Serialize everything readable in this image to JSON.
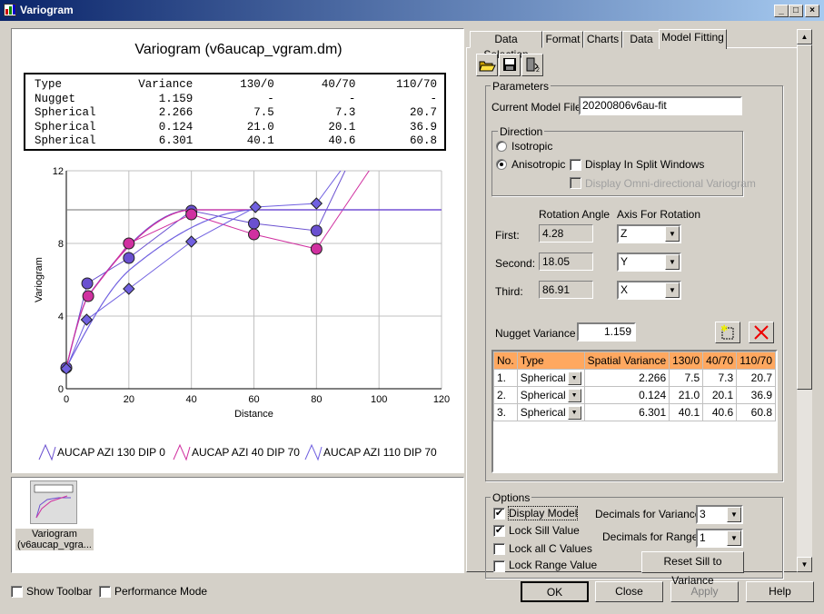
{
  "window": {
    "title": "Variogram",
    "icon": "variogram-app-icon",
    "buttons": [
      "minimize",
      "maximize",
      "close"
    ]
  },
  "chart_panel": {
    "title": "Variogram (v6aucap_vgram.dm)",
    "summary_table": {
      "headers": [
        "Type",
        "Variance",
        "130/0",
        "40/70",
        "110/70"
      ],
      "rows": [
        [
          "Nugget",
          "1.159",
          "-",
          "-",
          "-"
        ],
        [
          "Spherical",
          "2.266",
          "7.5",
          "7.3",
          "20.7"
        ],
        [
          "Spherical",
          "0.124",
          "21.0",
          "20.1",
          "36.9"
        ],
        [
          "Spherical",
          "6.301",
          "40.1",
          "40.6",
          "60.8"
        ]
      ]
    }
  },
  "chart_data": {
    "type": "line",
    "xlabel": "Distance",
    "ylabel": "Variogram",
    "xlim": [
      0,
      120
    ],
    "ylim": [
      0,
      12
    ],
    "xticks": [
      0,
      20,
      40,
      60,
      80,
      100,
      120
    ],
    "yticks": [
      0,
      4,
      8,
      12
    ],
    "grid": true,
    "legend_placement": "bottom",
    "sill": 9.85,
    "nugget": 1.159,
    "structures": [
      2.266,
      0.124,
      6.301
    ],
    "series": [
      {
        "name": "AUCAP AZI 130 DIP 0",
        "color": "#6a50d0",
        "marker": "circle",
        "ranges": [
          7.5,
          21.0,
          40.1
        ],
        "points": [
          [
            0,
            1.159
          ],
          [
            6.7,
            5.8
          ],
          [
            20,
            7.2
          ],
          [
            40,
            9.8
          ],
          [
            60,
            9.1
          ],
          [
            80,
            8.7
          ],
          [
            90,
            12.3
          ]
        ]
      },
      {
        "name": "AUCAP AZI 40 DIP 70",
        "color": "#d030a0",
        "marker": "circle",
        "ranges": [
          7.3,
          20.1,
          40.6
        ],
        "points": [
          [
            7,
            5.1
          ],
          [
            20,
            8.0
          ],
          [
            40,
            9.6
          ],
          [
            60,
            8.5
          ],
          [
            80,
            7.7
          ],
          [
            98,
            12.3
          ]
        ]
      },
      {
        "name": "AUCAP AZI 110 DIP 70",
        "color": "#7060e0",
        "marker": "diamond",
        "ranges": [
          20.7,
          36.9,
          60.8
        ],
        "points": [
          [
            0,
            1.1
          ],
          [
            6.5,
            3.8
          ],
          [
            20,
            5.5
          ],
          [
            40,
            8.1
          ],
          [
            60.5,
            10.0
          ],
          [
            80,
            10.2
          ],
          [
            89,
            12.3
          ]
        ]
      }
    ]
  },
  "thumbnail": {
    "label": "Variogram (v6aucap_vgra..."
  },
  "bottom": {
    "show_toolbar": "Show Toolbar",
    "show_toolbar_checked": false,
    "performance_mode": "Performance Mode",
    "performance_mode_checked": false,
    "ok": "OK",
    "close": "Close",
    "apply": "Apply",
    "help": "Help"
  },
  "tabs": [
    {
      "label": "Data Selection"
    },
    {
      "label": "Format"
    },
    {
      "label": "Charts"
    },
    {
      "label": "Data"
    },
    {
      "label": "Model Fitting",
      "active": true
    }
  ],
  "toolbar": {
    "icons": [
      "open-folder-icon",
      "save-icon",
      "export-icon"
    ]
  },
  "parameters": {
    "group": "Parameters",
    "model_file_label": "Current Model File :",
    "model_file": "20200806v6au-fit",
    "direction_group": "Direction",
    "isotropic": "Isotropic",
    "anisotropic": "Anisotropic",
    "selected": "Anisotropic",
    "split_windows": "Display In Split Windows",
    "split_windows_checked": false,
    "omni": "Display Omni-directional Variogram",
    "omni_checked": false,
    "rotation_angle_hdr": "Rotation Angle",
    "axis_hdr": "Axis For Rotation",
    "rotations": [
      {
        "label": "First:",
        "angle": "4.28",
        "axis": "Z"
      },
      {
        "label": "Second:",
        "angle": "18.05",
        "axis": "Y"
      },
      {
        "label": "Third:",
        "angle": "86.91",
        "axis": "X"
      }
    ],
    "nugget_label": "Nugget Variance :",
    "nugget": "1.159",
    "model_table": {
      "headers": [
        "No.",
        "Type",
        "Spatial Variance",
        "130/0",
        "40/70",
        "110/70"
      ],
      "rows": [
        [
          "1.",
          "Spherical",
          "2.266",
          "7.5",
          "7.3",
          "20.7"
        ],
        [
          "2.",
          "Spherical",
          "0.124",
          "21.0",
          "20.1",
          "36.9"
        ],
        [
          "3.",
          "Spherical",
          "6.301",
          "40.1",
          "40.6",
          "60.8"
        ]
      ]
    }
  },
  "options": {
    "group": "Options",
    "display_model": "Display Model",
    "display_model_checked": true,
    "lock_sill": "Lock Sill Value",
    "lock_sill_checked": true,
    "lock_c": "Lock all C Values",
    "lock_c_checked": false,
    "lock_range": "Lock Range Value",
    "lock_range_checked": false,
    "dec_var_label": "Decimals for Variances",
    "dec_var": "3",
    "dec_range_label": "Decimals for Ranges",
    "dec_range": "1",
    "reset": "Reset Sill to Variance"
  }
}
